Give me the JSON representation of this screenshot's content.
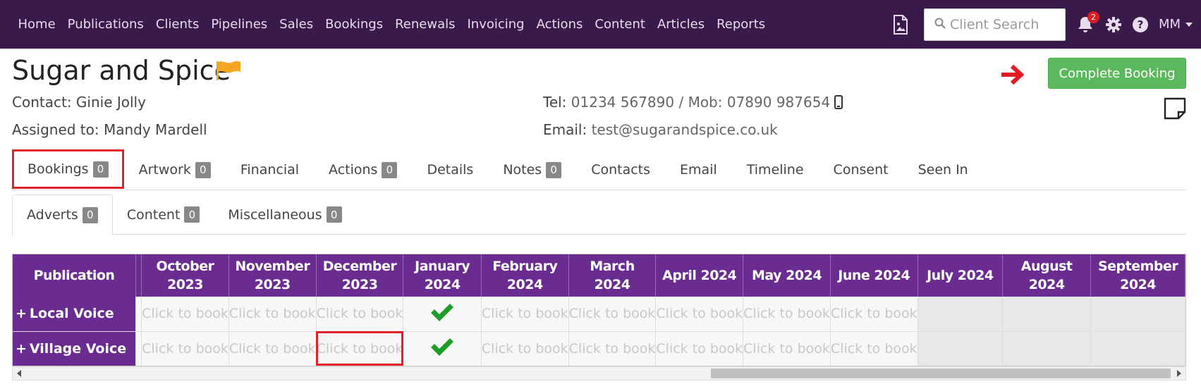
{
  "nav": {
    "links": [
      "Home",
      "Publications",
      "Clients",
      "Pipelines",
      "Sales",
      "Bookings",
      "Renewals",
      "Invoicing",
      "Actions",
      "Content",
      "Articles",
      "Reports"
    ],
    "search_placeholder": "Client Search",
    "notification_count": "2",
    "user_initials": "MM"
  },
  "client": {
    "name": "Sugar and Spice",
    "contact": "Contact: Ginie Jolly",
    "assigned": "Assigned to: Mandy Mardell",
    "tel_label": "Tel:",
    "tel_value": "01234 567890 / Mob: 07890 987654",
    "email_label": "Email:",
    "email_value": "test@sugarandspice.co.uk",
    "flag_color": "#f5a623"
  },
  "actions": {
    "complete_booking": "Complete Booking"
  },
  "main_tabs": [
    {
      "label": "Bookings",
      "count": "0"
    },
    {
      "label": "Artwork",
      "count": "0"
    },
    {
      "label": "Financial",
      "count": null
    },
    {
      "label": "Actions",
      "count": "0"
    },
    {
      "label": "Details",
      "count": null
    },
    {
      "label": "Notes",
      "count": "0"
    },
    {
      "label": "Contacts",
      "count": null
    },
    {
      "label": "Email",
      "count": null
    },
    {
      "label": "Timeline",
      "count": null
    },
    {
      "label": "Consent",
      "count": null
    },
    {
      "label": "Seen In",
      "count": null
    }
  ],
  "sub_tabs": [
    {
      "label": "Adverts",
      "count": "0"
    },
    {
      "label": "Content",
      "count": "0"
    },
    {
      "label": "Miscellaneous",
      "count": "0"
    }
  ],
  "grid": {
    "publication_header": "Publication",
    "months": [
      "October 2023",
      "November 2023",
      "December 2023",
      "January 2024",
      "February 2024",
      "March 2024",
      "April 2024",
      "May 2024",
      "June 2024",
      "July 2024",
      "August 2024",
      "September 2024"
    ],
    "click_text": "Click to book",
    "rows": [
      {
        "name": "Local Voice",
        "cells": [
          "book",
          "book",
          "book",
          "booked",
          "book",
          "book",
          "book",
          "book",
          "book",
          "disabled",
          "disabled",
          "disabled"
        ]
      },
      {
        "name": "Village Voice",
        "cells": [
          "book",
          "book",
          "book",
          "booked",
          "book",
          "book",
          "book",
          "book",
          "book",
          "disabled",
          "disabled",
          "disabled"
        ]
      }
    ],
    "header_color": "#6a2c91",
    "check_color": "#1e9e28"
  }
}
